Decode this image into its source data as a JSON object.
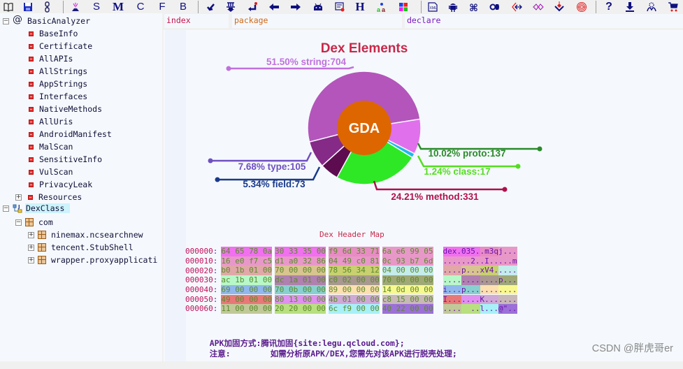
{
  "toolbar": {
    "buttons": [
      {
        "name": "open-book-icon",
        "kind": "svg"
      },
      {
        "name": "save-icon",
        "kind": "svg"
      },
      {
        "name": "link-chain-icon",
        "kind": "svg"
      },
      {
        "name": "separator"
      },
      {
        "name": "entry-point-icon",
        "kind": "svg"
      },
      {
        "name": "search-string-button",
        "kind": "letter",
        "label": "S"
      },
      {
        "name": "search-method-button",
        "kind": "letter",
        "label": "M",
        "serif": true
      },
      {
        "name": "search-class-button",
        "kind": "letter",
        "label": "C"
      },
      {
        "name": "search-field-button",
        "kind": "letter",
        "label": "F"
      },
      {
        "name": "bookmark-button",
        "kind": "letter",
        "label": "B"
      },
      {
        "name": "separator"
      },
      {
        "name": "goto-icon",
        "kind": "svg"
      },
      {
        "name": "download-method-icon",
        "kind": "svg"
      },
      {
        "name": "return-icon",
        "kind": "svg"
      },
      {
        "name": "back-arrow-icon",
        "kind": "svg"
      },
      {
        "name": "forward-arrow-icon",
        "kind": "svg"
      },
      {
        "name": "android-bot-icon",
        "kind": "svg"
      },
      {
        "name": "note-cert-icon",
        "kind": "svg"
      },
      {
        "name": "hex-header-button",
        "kind": "letter",
        "label": "H",
        "serif": true
      },
      {
        "name": "font-case-icon",
        "kind": "svg"
      },
      {
        "name": "color-blocks-icon",
        "kind": "svg"
      },
      {
        "name": "separator"
      },
      {
        "name": "xml-icon",
        "kind": "svg"
      },
      {
        "name": "android-robot-icon",
        "kind": "svg"
      },
      {
        "name": "command-icon",
        "kind": "svg"
      },
      {
        "name": "key-icon",
        "kind": "svg"
      },
      {
        "name": "decode-arrows-icon",
        "kind": "svg"
      },
      {
        "name": "network-graph-icon",
        "kind": "svg"
      },
      {
        "name": "vulnerability-icon",
        "kind": "svg"
      },
      {
        "name": "fingerprint-icon",
        "kind": "svg"
      },
      {
        "name": "separator"
      },
      {
        "name": "help-icon",
        "kind": "letter",
        "label": "?"
      },
      {
        "name": "download-icon",
        "kind": "svg"
      },
      {
        "name": "people-icon",
        "kind": "svg"
      },
      {
        "name": "cart-icon",
        "kind": "svg"
      }
    ]
  },
  "sidebar": {
    "root": {
      "label": "BasicAnalyzer",
      "icon": "at-icon",
      "expanded": true
    },
    "analyzer_items": [
      "BaseInfo",
      "Certificate",
      "AllAPIs",
      "AllStrings",
      "AppStrings",
      "Interfaces",
      "NativeMethods",
      "AllUris",
      "AndroidManifest",
      "MalScan",
      "SensitiveInfo",
      "VulScan",
      "PrivacyLeak",
      "Resources"
    ],
    "dexclass": {
      "label": "DexClass",
      "expanded": true,
      "selected": true
    },
    "package_root": {
      "label": "com",
      "expanded": true
    },
    "packages": [
      "ninemax.ncsearchnew",
      "tencent.StubShell",
      "wrapper.proxyapplicati"
    ]
  },
  "columns": {
    "index": "index",
    "package": "package",
    "declare": "declare"
  },
  "colors": {
    "index": "#c8104a",
    "package": "#d06818",
    "declare": "#7a18c0",
    "chart_title": "#c8284a",
    "center": "#dd6600"
  },
  "chart_data": {
    "type": "pie",
    "title": "Dex Elements",
    "center_label": "GDA",
    "slices": [
      {
        "name": "string",
        "percent": 51.5,
        "count": 704,
        "label": "51.50% string:704",
        "color": "#b455bb",
        "label_color": "#c070dd"
      },
      {
        "name": "proto",
        "percent": 10.02,
        "count": 137,
        "label": "10.02% proto:137",
        "color": "#e070ec",
        "label_color": "#2a8a2a"
      },
      {
        "name": "class",
        "percent": 1.24,
        "count": 17,
        "label": "1.24% class:17",
        "color": "#20b8e8",
        "label_color": "#55dd22"
      },
      {
        "name": "method",
        "percent": 24.21,
        "count": 331,
        "label": "24.21% method:331",
        "color": "#2ee826",
        "label_color": "#b0104c"
      },
      {
        "name": "field",
        "percent": 5.34,
        "count": 73,
        "label": "5.34% field:73",
        "color": "#5e0c50",
        "label_color": "#1a3a8a"
      },
      {
        "name": "type",
        "percent": 7.68,
        "count": 105,
        "label": "7.68% type:105",
        "color": "#862a88",
        "label_color": "#7050c0"
      }
    ]
  },
  "hex_map": {
    "title": "Dex Header Map",
    "rows": [
      {
        "offset": "000000",
        "bytes": [
          "64",
          "65",
          "78",
          "0a",
          "30",
          "33",
          "35",
          "00",
          "f9",
          "6d",
          "33",
          "71",
          "6a",
          "e6",
          "99",
          "05"
        ],
        "ascii": "dex.035..m3qj..."
      },
      {
        "offset": "000010",
        "bytes": [
          "16",
          "e0",
          "f7",
          "c5",
          "d1",
          "a0",
          "32",
          "86",
          "04",
          "49",
          "c0",
          "81",
          "0c",
          "93",
          "b7",
          "6d"
        ],
        "ascii": "......2..I.....m"
      },
      {
        "offset": "000020",
        "bytes": [
          "b0",
          "1b",
          "01",
          "00",
          "70",
          "00",
          "00",
          "00",
          "78",
          "56",
          "34",
          "12",
          "04",
          "00",
          "00",
          "00"
        ],
        "ascii": "....p...xV4....."
      },
      {
        "offset": "000030",
        "bytes": [
          "ac",
          "1b",
          "01",
          "00",
          "dc",
          "1a",
          "01",
          "00",
          "c0",
          "02",
          "00",
          "00",
          "70",
          "00",
          "00",
          "00"
        ],
        "ascii": "............p..."
      },
      {
        "offset": "000040",
        "bytes": [
          "69",
          "00",
          "00",
          "00",
          "70",
          "0b",
          "00",
          "00",
          "89",
          "00",
          "00",
          "00",
          "14",
          "0d",
          "00",
          "00"
        ],
        "ascii": "i...p..........."
      },
      {
        "offset": "000050",
        "bytes": [
          "49",
          "00",
          "00",
          "00",
          "80",
          "13",
          "00",
          "00",
          "4b",
          "01",
          "00",
          "00",
          "c8",
          "15",
          "00",
          "00"
        ],
        "ascii": "I.......K......."
      },
      {
        "offset": "000060",
        "bytes": [
          "11",
          "00",
          "00",
          "00",
          "20",
          "20",
          "00",
          "00",
          "6c",
          "f9",
          "00",
          "00",
          "40",
          "22",
          "00",
          "00"
        ],
        "ascii": "....  ..l...@\".."
      }
    ],
    "segments": [
      [
        {
          "s": 0,
          "e": 8,
          "c": "#f070f0"
        },
        {
          "s": 8,
          "e": 12,
          "c": "#e88cc4"
        },
        {
          "s": 12,
          "e": 16,
          "c": "#e898c8"
        }
      ],
      [
        {
          "s": 0,
          "e": 8,
          "c": "#e898c8"
        },
        {
          "s": 8,
          "e": 12,
          "c": "#e898c8"
        },
        {
          "s": 12,
          "e": 16,
          "c": "#e898c8"
        }
      ],
      [
        {
          "s": 0,
          "e": 4,
          "c": "#e0a8a8"
        },
        {
          "s": 4,
          "e": 8,
          "c": "#d8c490"
        },
        {
          "s": 8,
          "e": 12,
          "c": "#c8d070"
        },
        {
          "s": 12,
          "e": 16,
          "c": "#c4ecec"
        }
      ],
      [
        {
          "s": 0,
          "e": 4,
          "c": "#b8f8c8"
        },
        {
          "s": 4,
          "e": 8,
          "c": "#b080b0"
        },
        {
          "s": 8,
          "e": 12,
          "c": "#a89890"
        },
        {
          "s": 12,
          "e": 16,
          "c": "#a0a878"
        }
      ],
      [
        {
          "s": 0,
          "e": 4,
          "c": "#90b8ec"
        },
        {
          "s": 4,
          "e": 8,
          "c": "#88d0d0"
        },
        {
          "s": 8,
          "e": 12,
          "c": "#fce0b0"
        },
        {
          "s": 12,
          "e": 16,
          "c": "#f8f890"
        }
      ],
      [
        {
          "s": 0,
          "e": 4,
          "c": "#e87878"
        },
        {
          "s": 4,
          "e": 8,
          "c": "#e090f0"
        },
        {
          "s": 8,
          "e": 12,
          "c": "#d0a8d8"
        },
        {
          "s": 12,
          "e": 16,
          "c": "#c8b8b8"
        }
      ],
      [
        {
          "s": 0,
          "e": 4,
          "c": "#c0c898"
        },
        {
          "s": 4,
          "e": 8,
          "c": "#b8e080"
        },
        {
          "s": 8,
          "e": 12,
          "c": "#a8f0f8"
        },
        {
          "s": 12,
          "e": 16,
          "c": "#9c70d8"
        }
      ]
    ]
  },
  "notes": {
    "line1_label": "APK加固方式:",
    "line1_value": "腾讯加固{site:legu.qcloud.com};",
    "line2_label": "注意:",
    "line2_value": "如需分析原APK/DEX,您需先对该APK进行脱壳处理;"
  },
  "watermark": "CSDN @胖虎哥er"
}
